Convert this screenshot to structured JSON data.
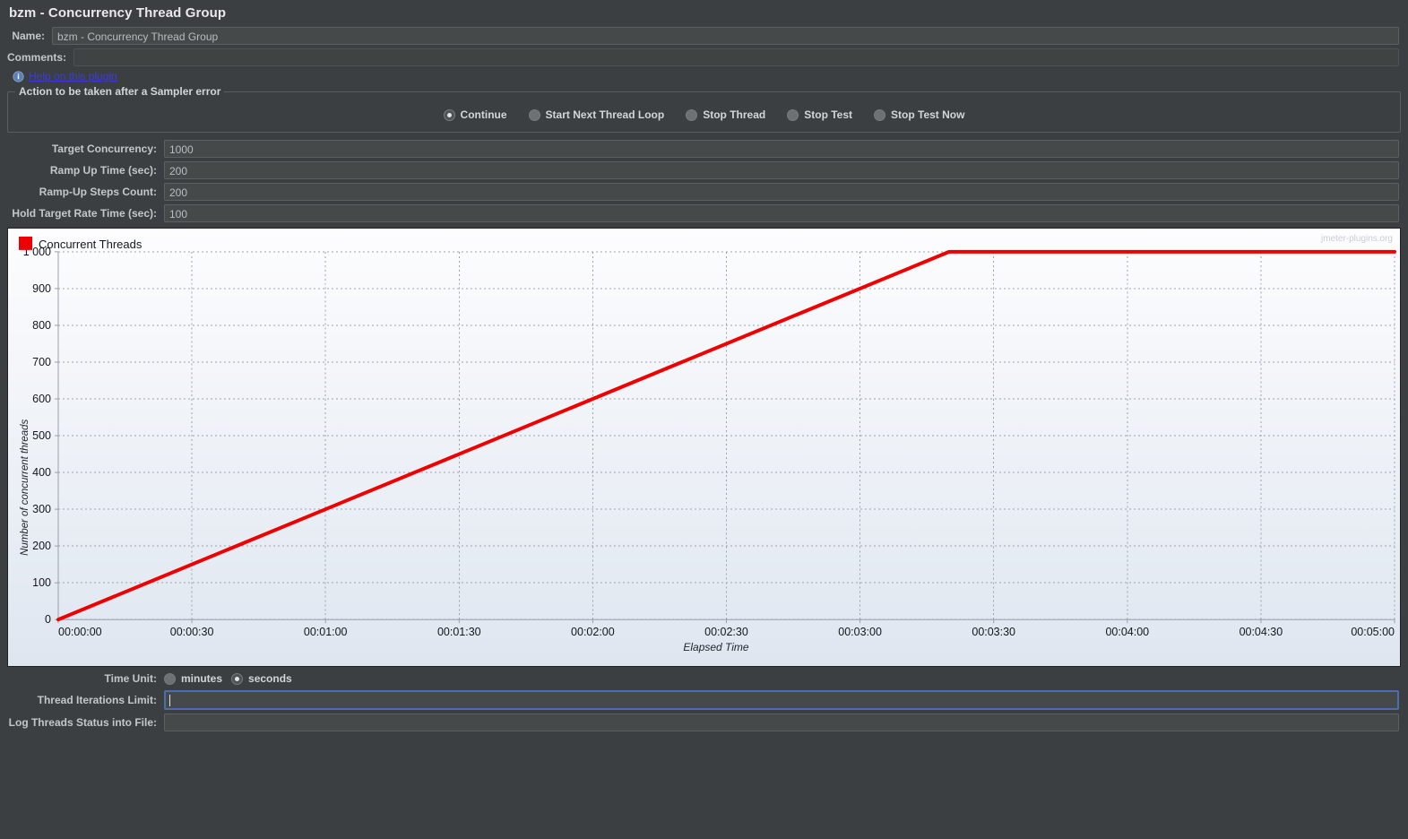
{
  "window": {
    "title": "bzm - Concurrency Thread Group"
  },
  "name_row": {
    "label": "Name:",
    "value": "bzm - Concurrency Thread Group"
  },
  "comments_row": {
    "label": "Comments:",
    "value": ""
  },
  "help": {
    "link_text": "Help on this plugin",
    "icon": "info-icon"
  },
  "error_action": {
    "title": "Action to be taken after a Sampler error",
    "options": [
      {
        "label": "Continue",
        "selected": true
      },
      {
        "label": "Start Next Thread Loop",
        "selected": false
      },
      {
        "label": "Stop Thread",
        "selected": false
      },
      {
        "label": "Stop Test",
        "selected": false
      },
      {
        "label": "Stop Test Now",
        "selected": false
      }
    ]
  },
  "fields": [
    {
      "label": "Target Concurrency:",
      "value": "1000"
    },
    {
      "label": "Ramp Up Time (sec):",
      "value": "200"
    },
    {
      "label": "Ramp-Up Steps Count:",
      "value": "200"
    },
    {
      "label": "Hold Target Rate Time (sec):",
      "value": "100"
    }
  ],
  "time_unit": {
    "label": "Time Unit:",
    "options": [
      {
        "label": "minutes",
        "selected": false
      },
      {
        "label": "seconds",
        "selected": true
      }
    ]
  },
  "bottom_fields": [
    {
      "label": "Thread Iterations Limit:",
      "value": "",
      "focused": true
    },
    {
      "label": "Log Threads Status into File:",
      "value": "",
      "focused": false
    }
  ],
  "colors": {
    "series": "#ee0000",
    "panel_bg": "#3c3f41",
    "field_bg": "#45494a",
    "link": "#3b3bdd",
    "focus_border": "#4b6eaf"
  },
  "chart_data": {
    "type": "line",
    "title": "",
    "watermark": "jmeter-plugins.org",
    "legend": [
      {
        "label": "Concurrent Threads",
        "color": "#ee0000"
      }
    ],
    "legend_position": "top-left",
    "xlabel": "Elapsed Time",
    "ylabel": "Number of concurrent threads",
    "grid": true,
    "xlim": [
      0,
      300
    ],
    "ylim": [
      0,
      1000
    ],
    "xticks": [
      0,
      30,
      60,
      90,
      120,
      150,
      180,
      210,
      240,
      270,
      300
    ],
    "xticklabels": [
      "00:00:00",
      "00:00:30",
      "00:01:00",
      "00:01:30",
      "00:02:00",
      "00:02:30",
      "00:03:00",
      "00:03:30",
      "00:04:00",
      "00:04:30",
      "00:05:00"
    ],
    "yticks": [
      0,
      100,
      200,
      300,
      400,
      500,
      600,
      700,
      800,
      900,
      1000
    ],
    "yticklabels": [
      "0",
      "100",
      "200",
      "300",
      "400",
      "500",
      "600",
      "700",
      "800",
      "900",
      "1 000"
    ],
    "series": [
      {
        "name": "Concurrent Threads",
        "color": "#ee0000",
        "x": [
          0,
          200,
          300
        ],
        "y": [
          0,
          1000,
          1000
        ]
      }
    ]
  }
}
